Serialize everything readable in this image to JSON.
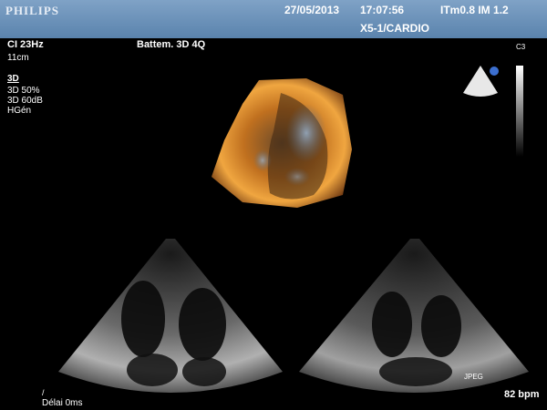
{
  "header": {
    "brand": "PHILIPS",
    "date": "27/05/2013",
    "time": "17:07:56",
    "params": "ITm0.8  IM 1.2",
    "probe": "X5-1/CARDIO"
  },
  "left_panel": {
    "ci": "CI 23Hz",
    "depth": "11cm",
    "mode": "3D",
    "settings": [
      "3D 50%",
      "3D 60dB",
      "HGén"
    ]
  },
  "preset": "Battem. 3D 4Q",
  "colormap_label": "C3",
  "overlay": {
    "jpeg": "JPEG",
    "slash": "/",
    "delay": "Délai 0ms",
    "heart_rate": "82 bpm"
  },
  "colors": {
    "header_top": "#7fa2c6",
    "header_bottom": "#5a83ad",
    "volume_render": "#e08a2a",
    "icon_dot": "#3c6fd0"
  },
  "icons": [
    "probe-orientation-icon",
    "grayscale-bar"
  ]
}
